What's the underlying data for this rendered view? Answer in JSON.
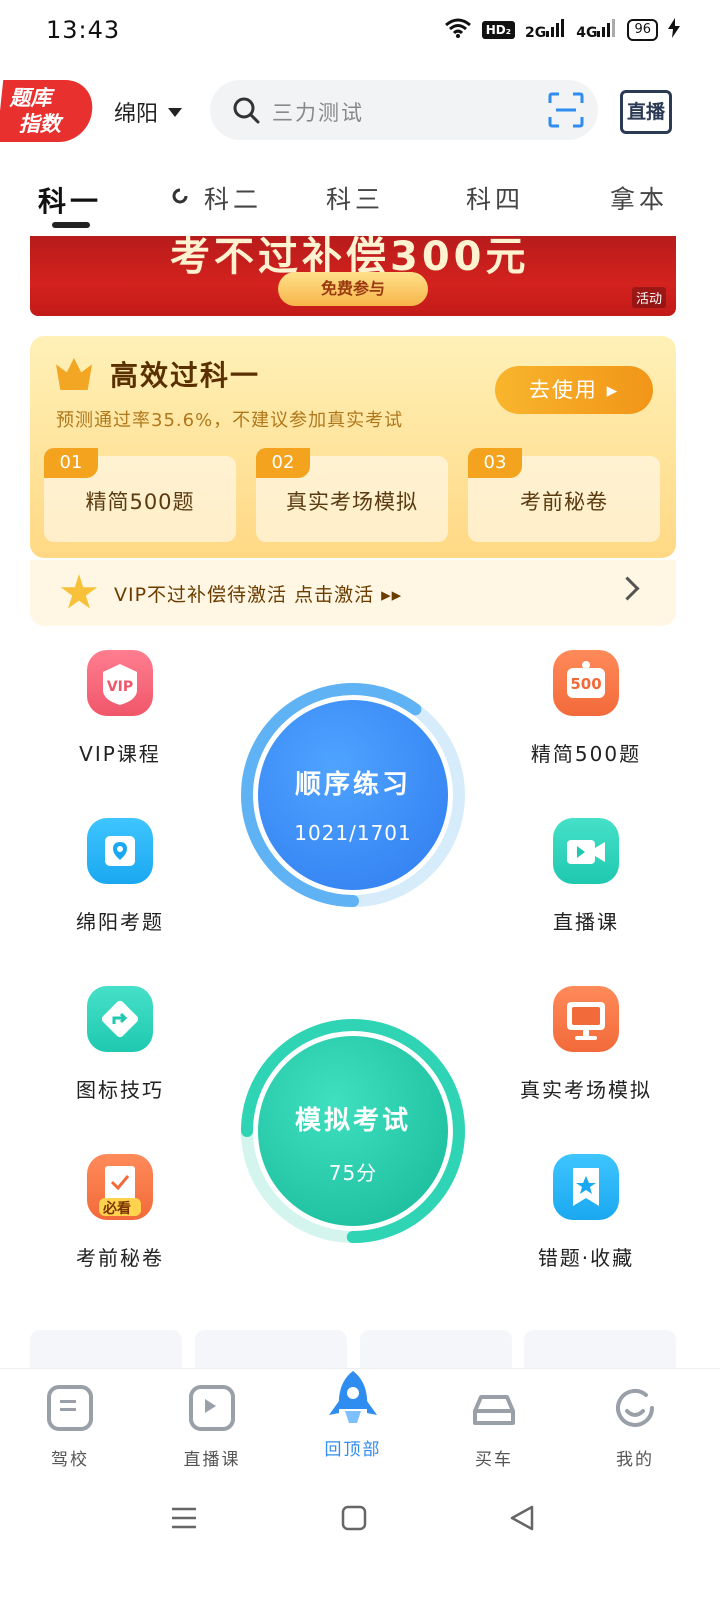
{
  "status": {
    "time": "13:43",
    "hd": "HD₂",
    "net1": "2G",
    "net2": "4G",
    "battery": "96"
  },
  "header": {
    "logo_line1": "题库",
    "logo_line2": "指数",
    "city": "绵阳",
    "search_placeholder": "三力测试",
    "live_label": "直播"
  },
  "tabs": [
    "科一",
    "科二",
    "科三",
    "科四",
    "拿本"
  ],
  "banner": {
    "headline": "考不过补偿300元",
    "button": "免费参与",
    "tag": "活动"
  },
  "vip_card": {
    "title": "高效过科一",
    "subtitle": "预测通过率35.6%，不建议参加真实考试",
    "use_button": "去使用 ▸",
    "features": [
      {
        "num": "01",
        "label": "精简500题"
      },
      {
        "num": "02",
        "label": "真实考场模拟"
      },
      {
        "num": "03",
        "label": "考前秘卷"
      }
    ],
    "bar_text": "VIP不过补偿待激活 点击激活 ▸▸"
  },
  "grid": {
    "left": [
      {
        "label": "VIP课程",
        "icon": "vip-icon",
        "color": "#f0566a"
      },
      {
        "label": "绵阳考题",
        "icon": "location-icon",
        "color": "#1aa8f0"
      },
      {
        "label": "图标技巧",
        "icon": "direction-sign-icon",
        "color": "#1ec9b0"
      },
      {
        "label": "考前秘卷",
        "icon": "exam-paper-icon",
        "color": "#f26a3a"
      }
    ],
    "right": [
      {
        "label": "精简500题",
        "icon": "500-icon",
        "color": "#f26a3a"
      },
      {
        "label": "直播课",
        "icon": "video-icon",
        "color": "#1ec9b0"
      },
      {
        "label": "真实考场模拟",
        "icon": "monitor-icon",
        "color": "#f26a3a"
      },
      {
        "label": "错题·收藏",
        "icon": "bookmark-star-icon",
        "color": "#1aa8f0"
      }
    ],
    "badge": "500",
    "must_see": "必看"
  },
  "practice": {
    "title": "顺序练习",
    "progress": "1021/1701",
    "progress_fraction": 0.6
  },
  "mock_exam": {
    "title": "模拟考试",
    "score": "75分",
    "score_fraction": 0.75
  },
  "tabbar": [
    {
      "label": "驾校",
      "icon": "school-icon"
    },
    {
      "label": "直播课",
      "icon": "tv-icon"
    },
    {
      "label": "回顶部",
      "icon": "rocket-icon"
    },
    {
      "label": "买车",
      "icon": "car-icon"
    },
    {
      "label": "我的",
      "icon": "profile-icon"
    }
  ],
  "colors": {
    "accent": "#2f8cf0",
    "vip": "#f3a31d",
    "red": "#e8302f",
    "teal": "#1ec9b0"
  }
}
